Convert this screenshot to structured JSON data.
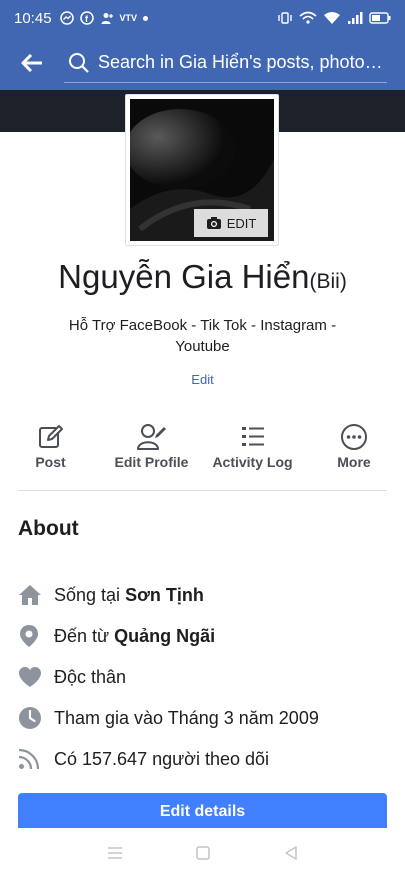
{
  "status_bar": {
    "time": "10:45",
    "notif_icons": [
      "messenger-icon",
      "facebook-icon",
      "user-add-icon",
      "vtv-icon"
    ],
    "vtv_label": "VTV"
  },
  "search": {
    "placeholder": "Search in Gia Hiển's posts, photos,..."
  },
  "profile": {
    "avatar_edit_label": "EDIT",
    "name": "Nguyễn Gia Hiển",
    "alternate_name": "(Bii)",
    "bio": "Hỗ Trợ FaceBook - Tik Tok - Instagram - Youtube",
    "bio_edit_label": "Edit"
  },
  "actions": [
    {
      "label": "Post",
      "icon": "compose-icon"
    },
    {
      "label": "Edit Profile",
      "icon": "edit-profile-icon"
    },
    {
      "label": "Activity Log",
      "icon": "list-icon"
    },
    {
      "label": "More",
      "icon": "more-icon"
    }
  ],
  "about": {
    "title": "About",
    "items": [
      {
        "prefix": "Sống tại ",
        "bold": "Sơn Tịnh",
        "icon": "home-icon"
      },
      {
        "prefix": "Đến từ ",
        "bold": "Quảng Ngãi",
        "icon": "location-pin-icon"
      },
      {
        "prefix": "Độc thân",
        "bold": "",
        "icon": "heart-icon"
      },
      {
        "prefix": "Tham gia vào Tháng 3 năm 2009",
        "bold": "",
        "icon": "clock-icon"
      },
      {
        "prefix": "Có 157.647 người theo dõi",
        "bold": "",
        "icon": "rss-icon"
      }
    ],
    "edit_details_label": "Edit details"
  },
  "colors": {
    "brand": "#4267b2",
    "button": "#4080ff",
    "cover": "#1d2129"
  }
}
